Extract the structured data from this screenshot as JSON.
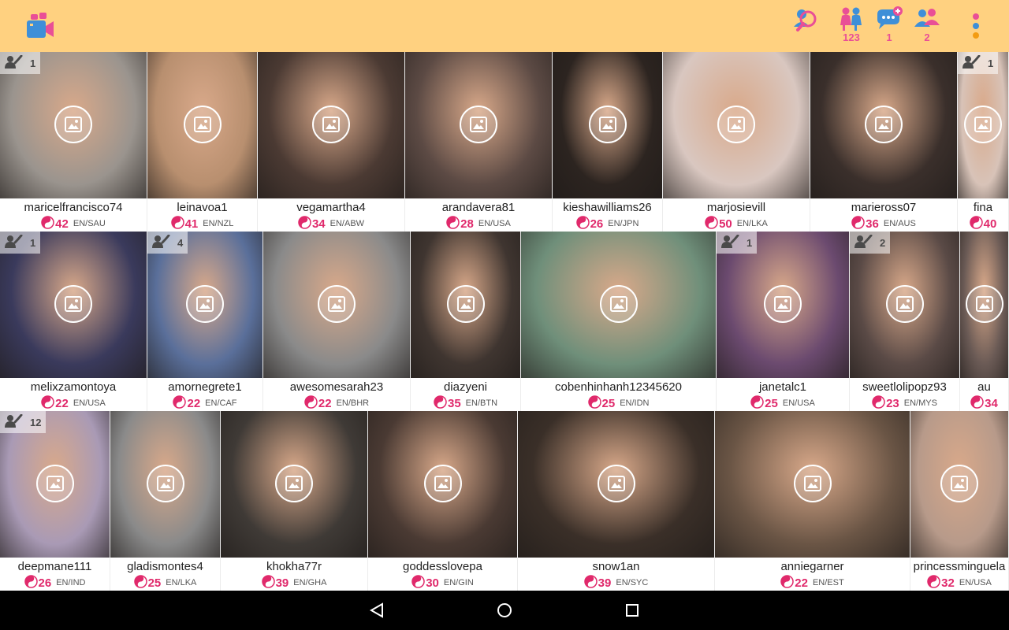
{
  "app": {
    "logo_icon": "video-camera-icon",
    "accent_color": "#e94f96",
    "topbar_color": "#ffd180"
  },
  "toolbar": {
    "search_icon": "people-search-icon",
    "visitors": {
      "icon": "visitors-icon",
      "count": "123"
    },
    "messages": {
      "icon": "chat-bubble-icon",
      "count": "1"
    },
    "friends": {
      "icon": "friends-group-icon",
      "count": "2"
    },
    "menu_icon": "overflow-menu-icon"
  },
  "profiles": [
    [
      {
        "name": "maricelfrancisco74",
        "age": "42",
        "loc": "EN/SAU",
        "album": "1"
      },
      {
        "name": "leinavoa1",
        "age": "41",
        "loc": "EN/NZL",
        "album": ""
      },
      {
        "name": "vegamartha4",
        "age": "34",
        "loc": "EN/ABW",
        "album": ""
      },
      {
        "name": "arandavera81",
        "age": "28",
        "loc": "EN/USA",
        "album": ""
      },
      {
        "name": "kieshawilliams26",
        "age": "26",
        "loc": "EN/JPN",
        "album": ""
      },
      {
        "name": "marjosievill",
        "age": "50",
        "loc": "EN/LKA",
        "album": ""
      },
      {
        "name": "marieross07",
        "age": "36",
        "loc": "EN/AUS",
        "album": ""
      },
      {
        "name": "fina",
        "age": "40",
        "loc": "",
        "album": "1"
      }
    ],
    [
      {
        "name": "melixzamontoya",
        "age": "22",
        "loc": "EN/USA",
        "album": "1"
      },
      {
        "name": "amornegrete1",
        "age": "22",
        "loc": "EN/CAF",
        "album": "4"
      },
      {
        "name": "awesomesarah23",
        "age": "22",
        "loc": "EN/BHR",
        "album": ""
      },
      {
        "name": "diazyeni",
        "age": "35",
        "loc": "EN/BTN",
        "album": ""
      },
      {
        "name": "cobenhinhanh12345620",
        "age": "25",
        "loc": "EN/IDN",
        "album": ""
      },
      {
        "name": "janetalc1",
        "age": "25",
        "loc": "EN/USA",
        "album": "1"
      },
      {
        "name": "sweetlolipopz93",
        "age": "23",
        "loc": "EN/MYS",
        "album": "2"
      },
      {
        "name": "au",
        "age": "34",
        "loc": "",
        "album": ""
      }
    ],
    [
      {
        "name": "deepmane111",
        "age": "26",
        "loc": "EN/IND",
        "album": "12"
      },
      {
        "name": "gladismontes4",
        "age": "25",
        "loc": "EN/LKA",
        "album": ""
      },
      {
        "name": "khokha77r",
        "age": "39",
        "loc": "EN/GHA",
        "album": ""
      },
      {
        "name": "goddesslovepa",
        "age": "30",
        "loc": "EN/GIN",
        "album": ""
      },
      {
        "name": "snow1an",
        "age": "39",
        "loc": "EN/SYC",
        "album": ""
      },
      {
        "name": "anniegarner",
        "age": "22",
        "loc": "EN/EST",
        "album": ""
      },
      {
        "name": "princessminguela",
        "age": "32",
        "loc": "EN/USA",
        "album": ""
      }
    ]
  ],
  "navbar": {
    "back_icon": "back-triangle-icon",
    "home_icon": "home-circle-icon",
    "recents_icon": "recents-square-icon"
  }
}
